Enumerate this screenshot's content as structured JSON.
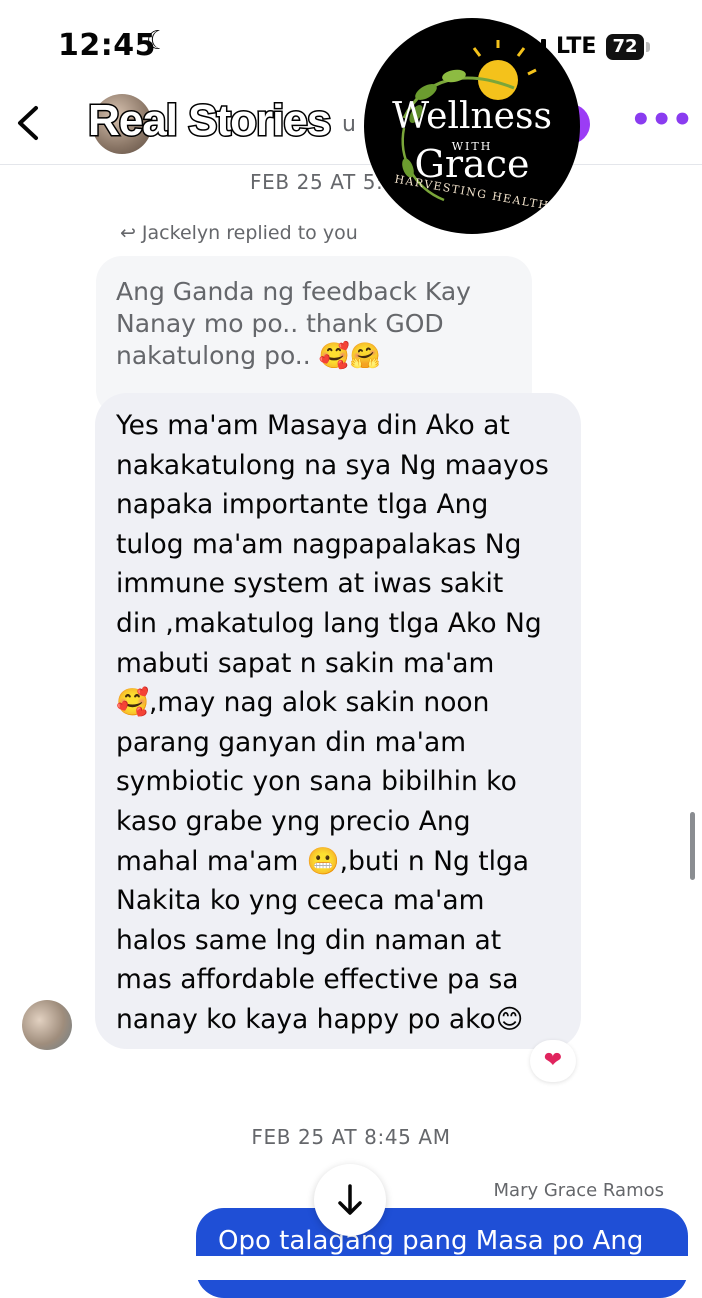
{
  "status_bar": {
    "time": "12:45",
    "network": "LTE",
    "battery": "72"
  },
  "header": {
    "title": "Real Stories",
    "subtitle_fragment": "u"
  },
  "logo": {
    "line1": "Wellness",
    "with": "WITH",
    "line2": "Grace",
    "tagline": "HARVESTING HEALTH"
  },
  "conversation": {
    "timestamp_1": "FEB 25 AT 5:",
    "replied_label": "Jackelyn replied to you",
    "quoted_message": "Ang Ganda ng feedback Kay Nanay mo po.. thank GOD nakatulong po.. 🥰🤗",
    "reply_message": "Yes ma'am Masaya din Ako at\nnakakatulong na sya Ng maayos\nnapaka importante tlga Ang\ntulog ma'am nagpapalakas Ng\nimmune system at iwas sakit\ndin ,makatulog lang tlga Ako Ng\nmabuti sapat n sakin ma'am\n🥰,may nag alok sakin noon\nparang ganyan din ma'am\nsymbiotic yon sana bibilhin ko\nkaso grabe yng precio Ang\nmahal ma'am 😬,buti n Ng tlga\nNakita ko yng ceeca ma'am\nhalos same lng din naman at\nmas affordable effective pa sa\nnanay ko kaya happy po ako😊",
    "reaction": "❤",
    "timestamp_2": "FEB 25 AT 8:45 AM",
    "my_name": "Mary Grace Ramos",
    "my_message": "Opo talagang pang Masa po Ang"
  },
  "icons": {
    "back": "chevron-left-icon",
    "more": "more-dots-icon",
    "reply": "reply-arrow-icon",
    "scroll": "arrow-down-icon",
    "moon": "moon-icon"
  },
  "colors": {
    "accent": "#9b3cf5",
    "my_bubble": "#1f4fd6",
    "their_bubble": "#eff0f5"
  }
}
